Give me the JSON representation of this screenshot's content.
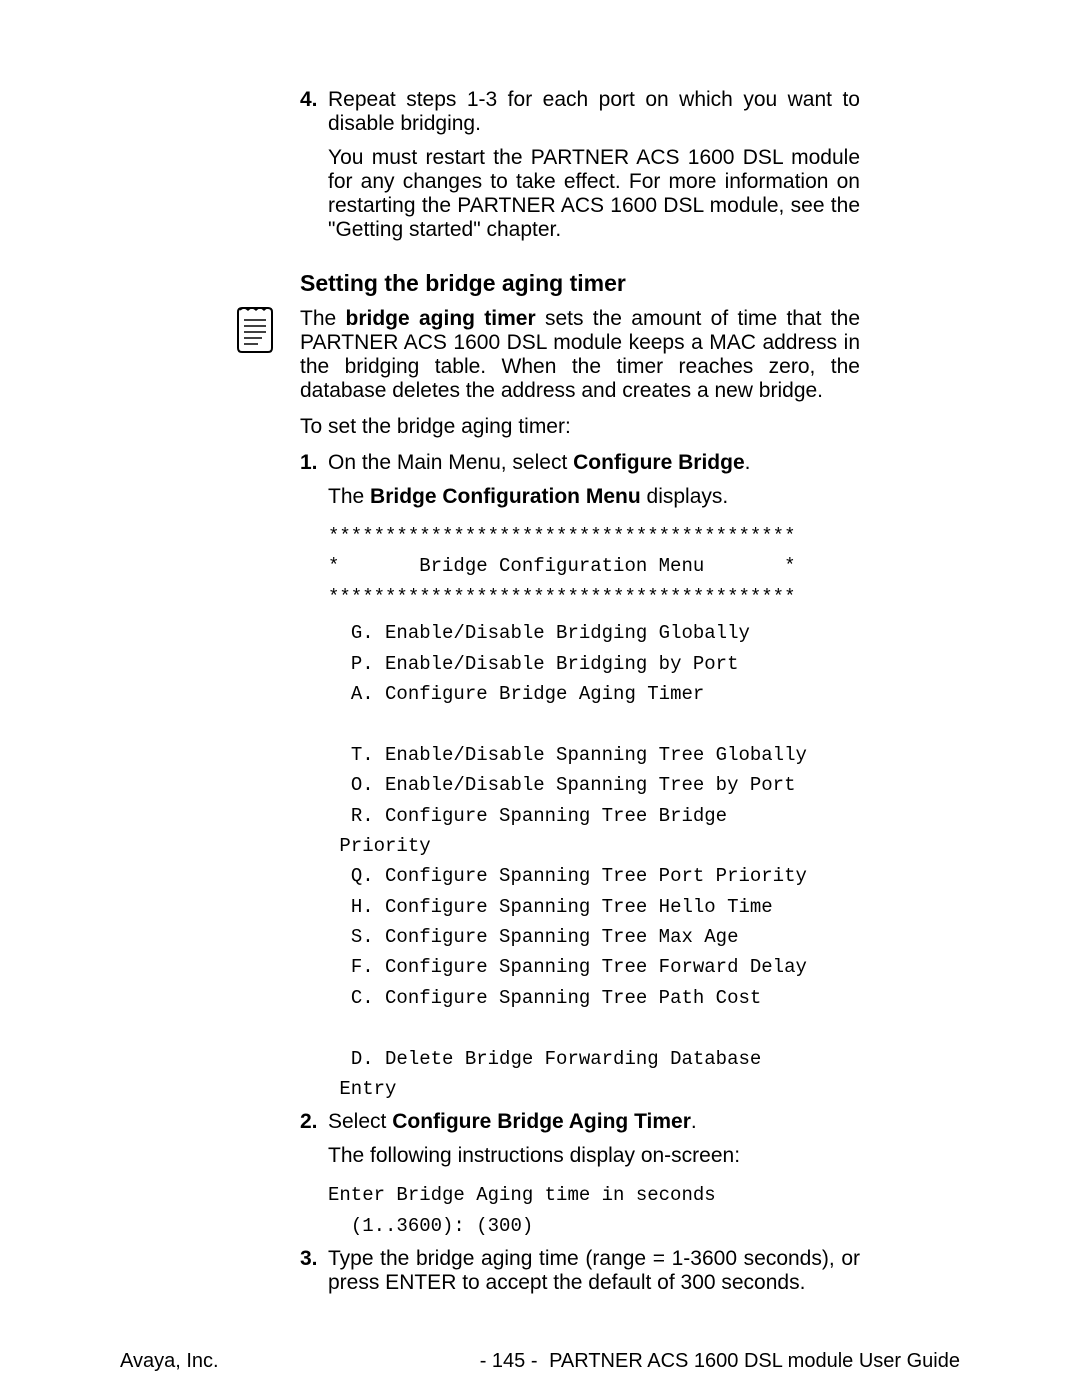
{
  "step4": {
    "num": "4.",
    "text": "Repeat steps 1-3 for each port on which you want to disable bridging.",
    "note": "You must restart the PARTNER ACS 1600 DSL module for any changes to take effect.  For more information on restarting the PARTNER ACS 1600 DSL module, see the \"Getting started\" chapter."
  },
  "section": {
    "title": "Setting the bridge aging timer",
    "intro_pre": "The ",
    "intro_bold": "bridge aging timer",
    "intro_post": " sets the amount of time that the PARTNER ACS 1600 DSL module keeps a MAC address in the bridging table.  When the timer reaches zero, the database deletes the address and creates a new bridge.",
    "lead": "To set the bridge aging timer:"
  },
  "step1": {
    "num": "1.",
    "pre": "On the Main Menu, select ",
    "bold": "Configure Bridge",
    "post": ".",
    "result_pre": "The ",
    "result_bold": "Bridge Configuration Menu",
    "result_post": " displays."
  },
  "menu": {
    "stars1": "*****************************************",
    "title": "*       Bridge Configuration Menu       *",
    "stars2": "*****************************************",
    "items": [
      "  G. Enable/Disable Bridging Globally",
      "  P. Enable/Disable Bridging by Port",
      "  A. Configure Bridge Aging Timer",
      "",
      "  T. Enable/Disable Spanning Tree Globally",
      "  O. Enable/Disable Spanning Tree by Port",
      "  R. Configure Spanning Tree Bridge\n Priority",
      "  Q. Configure Spanning Tree Port Priority",
      "  H. Configure Spanning Tree Hello Time",
      "  S. Configure Spanning Tree Max Age",
      "  F. Configure Spanning Tree Forward Delay",
      "  C. Configure Spanning Tree Path Cost",
      "",
      "  D. Delete Bridge Forwarding Database\n Entry"
    ]
  },
  "step2": {
    "num": "2.",
    "pre": "Select ",
    "bold": "Configure Bridge Aging Timer",
    "post": ".",
    "result": "The following instructions display on-screen:",
    "code": "Enter Bridge Aging time in seconds\n  (1..3600): (300)"
  },
  "step3": {
    "num": "3.",
    "text": "Type the bridge aging time (range = 1-3600 seconds), or press ENTER to accept the default of 300 seconds."
  },
  "footer": {
    "left": "Avaya, Inc.",
    "center": "- 145 -",
    "right": "PARTNER ACS 1600 DSL module User Guide"
  }
}
